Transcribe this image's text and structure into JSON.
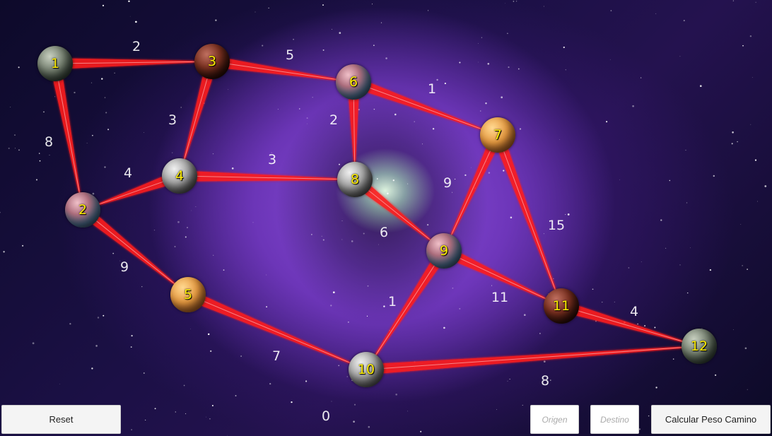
{
  "graph": {
    "nodes": [
      {
        "id": "1",
        "style": "p-green"
      },
      {
        "id": "2",
        "style": "p-pinkblue"
      },
      {
        "id": "3",
        "style": "p-red"
      },
      {
        "id": "4",
        "style": "p-grey"
      },
      {
        "id": "5",
        "style": "p-orange"
      },
      {
        "id": "6",
        "style": "p-pinkblue"
      },
      {
        "id": "7",
        "style": "p-orange"
      },
      {
        "id": "8",
        "style": "p-grey"
      },
      {
        "id": "9",
        "style": "p-pinkblue"
      },
      {
        "id": "10",
        "style": "p-grey"
      },
      {
        "id": "11",
        "style": "p-red"
      },
      {
        "id": "12",
        "style": "p-green"
      }
    ],
    "edges": [
      {
        "from": "1",
        "to": "3",
        "weight": "2"
      },
      {
        "from": "1",
        "to": "2",
        "weight": "8"
      },
      {
        "from": "3",
        "to": "6",
        "weight": "5"
      },
      {
        "from": "3",
        "to": "4",
        "weight": "3"
      },
      {
        "from": "4",
        "to": "2",
        "weight": "4"
      },
      {
        "from": "4",
        "to": "8",
        "weight": "3"
      },
      {
        "from": "6",
        "to": "7",
        "weight": "1"
      },
      {
        "from": "6",
        "to": "8",
        "weight": "2"
      },
      {
        "from": "7",
        "to": "9",
        "weight": "9"
      },
      {
        "from": "7",
        "to": "11",
        "weight": "15"
      },
      {
        "from": "8",
        "to": "9",
        "weight": "6"
      },
      {
        "from": "2",
        "to": "5",
        "weight": "9"
      },
      {
        "from": "9",
        "to": "10",
        "weight": "1"
      },
      {
        "from": "9",
        "to": "11",
        "weight": "11"
      },
      {
        "from": "5",
        "to": "10",
        "weight": "7"
      },
      {
        "from": "11",
        "to": "12",
        "weight": "4"
      },
      {
        "from": "10",
        "to": "12",
        "weight": "8"
      }
    ],
    "edge_color": "#ff1e1e"
  },
  "result_value": "0",
  "controls": {
    "reset_label": "Reset",
    "origin_placeholder": "Origen",
    "destination_placeholder": "Destino",
    "calculate_label": "Calcular Peso Camino"
  }
}
